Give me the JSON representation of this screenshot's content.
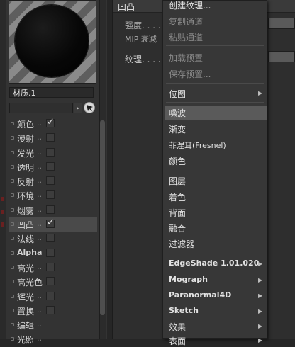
{
  "material": {
    "name": "材质.1"
  },
  "channels": [
    {
      "label": "颜色",
      "checked": true
    },
    {
      "label": "漫射",
      "checked": false
    },
    {
      "label": "发光",
      "checked": false
    },
    {
      "label": "透明",
      "checked": false
    },
    {
      "label": "反射",
      "checked": false
    },
    {
      "label": "环境",
      "checked": false
    },
    {
      "label": "烟雾",
      "checked": false
    },
    {
      "label": "凹凸",
      "checked": true,
      "selected": true
    },
    {
      "label": "法线",
      "checked": false
    },
    {
      "label": "Alpha",
      "checked": false
    },
    {
      "label": "高光",
      "checked": false
    },
    {
      "label": "高光色",
      "checked": false
    },
    {
      "label": "辉光",
      "checked": false
    },
    {
      "label": "置换",
      "checked": false
    },
    {
      "label": "编辑",
      "checked": null
    },
    {
      "label": "光照",
      "checked": null
    }
  ],
  "attributes": {
    "title": "凹凸",
    "strength_label": "强度. . . . . .",
    "mip_label": "MIP 衰减",
    "texture_label": "纹理. . . . . ."
  },
  "context_menu": {
    "items": [
      {
        "label": "创建纹理...",
        "disabled": false
      },
      {
        "label": "复制通道",
        "disabled": true
      },
      {
        "label": "粘贴通道",
        "disabled": true
      },
      {
        "label": "加载预置",
        "disabled": true
      },
      {
        "label": "保存预置...",
        "disabled": true
      },
      {
        "label": "位图",
        "submenu": true
      },
      {
        "label": "噪波",
        "highlighted": true
      },
      {
        "label": "渐变"
      },
      {
        "label": "菲涅耳(Fresnel)"
      },
      {
        "label": "颜色"
      },
      {
        "label": "图层"
      },
      {
        "label": "着色"
      },
      {
        "label": "背面"
      },
      {
        "label": "融合"
      },
      {
        "label": "过滤器"
      },
      {
        "label": "EdgeShade 1.01.020",
        "submenu": true
      },
      {
        "label": "Mograph",
        "submenu": true
      },
      {
        "label": "Paranormal4D",
        "submenu": true
      },
      {
        "label": "Sketch",
        "submenu": true
      },
      {
        "label": "效果",
        "submenu": true
      },
      {
        "label": "表面",
        "submenu": true
      }
    ]
  },
  "colors": {
    "panel_bg": "#333333",
    "menu_bg": "#373737",
    "menu_highlight": "#5a5a5a",
    "text": "#e2e2e2",
    "text_disabled": "#8a8a8a"
  }
}
